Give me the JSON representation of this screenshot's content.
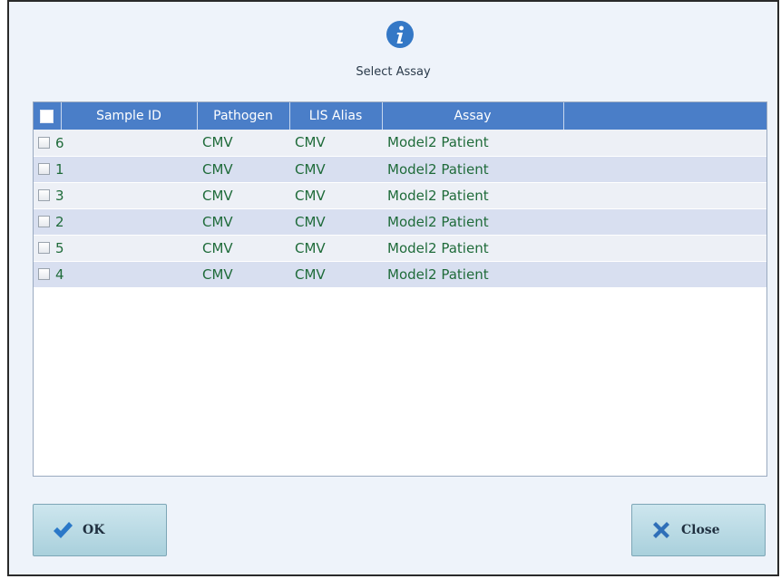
{
  "dialog": {
    "title": "Select Assay"
  },
  "table": {
    "columns": [
      "Sample ID",
      "Pathogen",
      "LIS Alias",
      "Assay",
      ""
    ],
    "rows": [
      {
        "sample_id": "6",
        "pathogen": "CMV",
        "lis_alias": "CMV",
        "assay": "Model2 Patient"
      },
      {
        "sample_id": "1",
        "pathogen": "CMV",
        "lis_alias": "CMV",
        "assay": "Model2 Patient"
      },
      {
        "sample_id": "3",
        "pathogen": "CMV",
        "lis_alias": "CMV",
        "assay": "Model2 Patient"
      },
      {
        "sample_id": "2",
        "pathogen": "CMV",
        "lis_alias": "CMV",
        "assay": "Model2 Patient"
      },
      {
        "sample_id": "5",
        "pathogen": "CMV",
        "lis_alias": "CMV",
        "assay": "Model2 Patient"
      },
      {
        "sample_id": "4",
        "pathogen": "CMV",
        "lis_alias": "CMV",
        "assay": "Model2 Patient"
      }
    ]
  },
  "buttons": {
    "ok_label": "OK",
    "close_label": "Close"
  },
  "icons": {
    "info": "info-icon",
    "ok": "checkmark-icon",
    "close": "x-icon"
  },
  "colors": {
    "header_blue": "#4a7ec8",
    "text_green": "#1f6b3a",
    "button_teal": "#a9d0dc",
    "check_blue": "#2a78c8",
    "close_blue": "#2f6fb8"
  }
}
